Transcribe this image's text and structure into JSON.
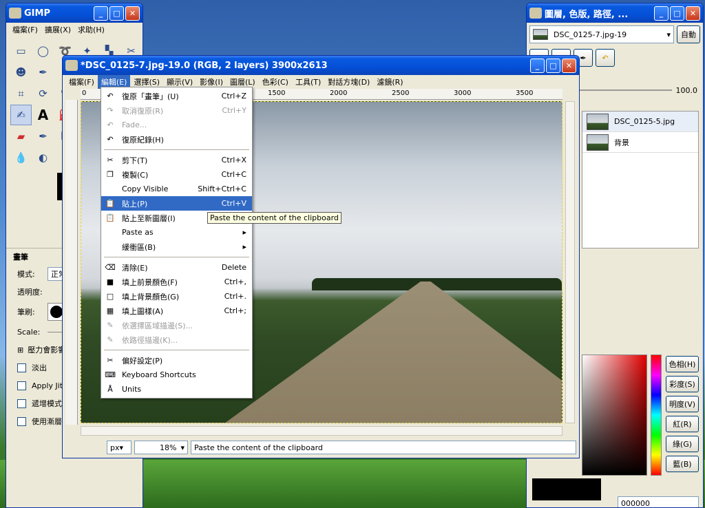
{
  "toolbox": {
    "title": "GIMP",
    "menu": [
      "檔案(F)",
      "擴展(X)",
      "求助(H)"
    ],
    "options_title": "畫筆",
    "mode_label": "模式:",
    "mode_value": "正常",
    "opacity_label": "透明度:",
    "brush_label": "筆刷:",
    "scale_label": "Scale:",
    "pressure_label": "壓力會影響",
    "fade_label": "淡出",
    "jitter_label": "Apply Jitte",
    "incremental_label": "遞增模式",
    "gradient_label": "使用漸層中"
  },
  "image_window": {
    "title": "*DSC_0125-7.jpg-19.0 (RGB, 2 layers) 3900x2613",
    "menu": [
      "檔案(F)",
      "編輯(E)",
      "選擇(S)",
      "顯示(V)",
      "影像(I)",
      "圖層(L)",
      "色彩(C)",
      "工具(T)",
      "對話方塊(D)",
      "濾鏡(R)"
    ],
    "ruler_ticks": [
      "0",
      "1500",
      "2000",
      "2500",
      "3000",
      "3500"
    ],
    "unit": "px",
    "zoom": "18%",
    "status": "Paste the content of the clipboard"
  },
  "edit_menu": {
    "items": [
      {
        "label": "復原「畫筆」(U)",
        "accel": "Ctrl+Z",
        "icon": "undo-icon",
        "glyph": "↶",
        "state": "normal"
      },
      {
        "label": "取消復原(R)",
        "accel": "Ctrl+Y",
        "icon": "redo-icon",
        "glyph": "↷",
        "state": "disabled"
      },
      {
        "label": "Fade...",
        "accel": "",
        "icon": "fade-icon",
        "glyph": "↶",
        "state": "disabled"
      },
      {
        "label": "復原紀錄(H)",
        "accel": "",
        "icon": "undo-history-icon",
        "glyph": "↶",
        "state": "normal"
      },
      {
        "sep": true
      },
      {
        "label": "剪下(T)",
        "accel": "Ctrl+X",
        "icon": "cut-icon",
        "glyph": "✂",
        "state": "normal"
      },
      {
        "label": "複製(C)",
        "accel": "Ctrl+C",
        "icon": "copy-icon",
        "glyph": "❐",
        "state": "normal"
      },
      {
        "label": "Copy Visible",
        "accel": "Shift+Ctrl+C",
        "icon": "",
        "glyph": "",
        "state": "normal"
      },
      {
        "label": "貼上(P)",
        "accel": "Ctrl+V",
        "icon": "paste-icon",
        "glyph": "📋",
        "state": "highlighted"
      },
      {
        "label": "貼上至新圖層(I)",
        "accel": "",
        "icon": "paste-new-layer-icon",
        "glyph": "📋",
        "state": "normal"
      },
      {
        "label": "Paste as",
        "accel": "",
        "icon": "",
        "glyph": "",
        "state": "submenu"
      },
      {
        "label": "緩衝區(B)",
        "accel": "",
        "icon": "",
        "glyph": "",
        "state": "submenu"
      },
      {
        "sep": true
      },
      {
        "label": "清除(E)",
        "accel": "Delete",
        "icon": "clear-icon",
        "glyph": "⌫",
        "state": "normal"
      },
      {
        "label": "填上前景顏色(F)",
        "accel": "Ctrl+,",
        "icon": "fg-fill-icon",
        "glyph": "■",
        "state": "normal"
      },
      {
        "label": "填上背景顏色(G)",
        "accel": "Ctrl+.",
        "icon": "bg-fill-icon",
        "glyph": "□",
        "state": "normal"
      },
      {
        "label": "填上圖樣(A)",
        "accel": "Ctrl+;",
        "icon": "pattern-fill-icon",
        "glyph": "▦",
        "state": "normal"
      },
      {
        "label": "依選擇區域描邊(S)...",
        "accel": "",
        "icon": "stroke-selection-icon",
        "glyph": "✎",
        "state": "disabled"
      },
      {
        "label": "依路徑描邊(K)...",
        "accel": "",
        "icon": "stroke-path-icon",
        "glyph": "✎",
        "state": "disabled"
      },
      {
        "sep": true
      },
      {
        "label": "偏好設定(P)",
        "accel": "",
        "icon": "preferences-icon",
        "glyph": "✂",
        "state": "normal"
      },
      {
        "label": "Keyboard Shortcuts",
        "accel": "",
        "icon": "keyboard-icon",
        "glyph": "⌨",
        "state": "normal"
      },
      {
        "label": "Units",
        "accel": "",
        "icon": "units-icon",
        "glyph": "Å",
        "state": "normal"
      }
    ]
  },
  "tooltip": "Paste the content of the clipboard",
  "layers_dock": {
    "title": "圖層, 色版, 路徑, ...",
    "image_selector": "DSC_0125-7.jpg-19",
    "auto_button": "自動",
    "opacity_value": "100.0",
    "layers": [
      "DSC_0125-5.jpg",
      "背景"
    ],
    "color_buttons": [
      "色相(H)",
      "彩度(S)",
      "明度(V)",
      "紅(R)",
      "綠(G)",
      "藍(B)"
    ],
    "hex_value": "000000"
  }
}
